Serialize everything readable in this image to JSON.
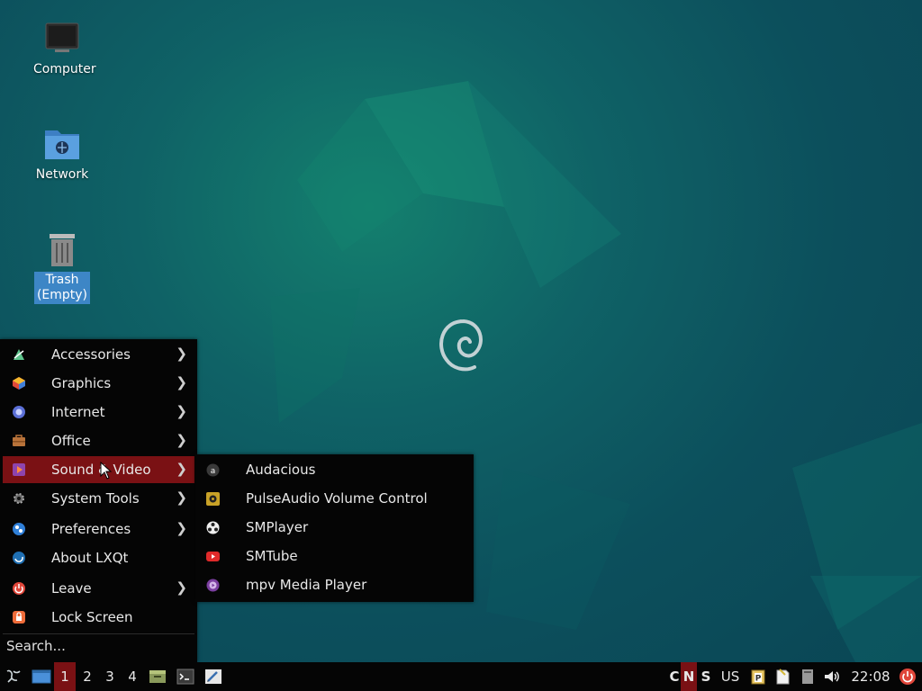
{
  "desktop": {
    "icons": [
      {
        "label": "Computer"
      },
      {
        "label": "Network"
      },
      {
        "label": "Trash\n(Empty)",
        "line1": "Trash",
        "line2": "(Empty)"
      }
    ]
  },
  "menu": {
    "items": [
      {
        "label": "Accessories",
        "icon": "accessories-icon",
        "submenu": true
      },
      {
        "label": "Graphics",
        "icon": "graphics-icon",
        "submenu": true
      },
      {
        "label": "Internet",
        "icon": "internet-icon",
        "submenu": true
      },
      {
        "label": "Office",
        "icon": "office-icon",
        "submenu": true
      },
      {
        "label": "Sound & Video",
        "icon": "sound-video-icon",
        "submenu": true,
        "active": true
      },
      {
        "label": "System Tools",
        "icon": "system-tools-icon",
        "submenu": true
      },
      {
        "label": "Preferences",
        "icon": "preferences-icon",
        "submenu": true
      },
      {
        "label": "About LXQt",
        "icon": "about-lxqt-icon",
        "submenu": false
      },
      {
        "label": "Leave",
        "icon": "leave-icon",
        "submenu": true
      },
      {
        "label": "Lock Screen",
        "icon": "lock-screen-icon",
        "submenu": false
      }
    ],
    "arrow": "❯",
    "search_placeholder": "Search..."
  },
  "submenu": {
    "items": [
      {
        "label": "Audacious",
        "icon": "audacious-icon"
      },
      {
        "label": "PulseAudio Volume Control",
        "icon": "pulseaudio-icon"
      },
      {
        "label": "SMPlayer",
        "icon": "smplayer-icon"
      },
      {
        "label": "SMTube",
        "icon": "smtube-icon"
      },
      {
        "label": "mpv Media Player",
        "icon": "mpv-icon"
      }
    ]
  },
  "taskbar": {
    "workspaces": [
      "1",
      "2",
      "3",
      "4"
    ],
    "active_workspace": "1",
    "keyboard_indicators": [
      "C",
      "N",
      "S"
    ],
    "active_indicator": "N",
    "layout": "US",
    "clock": "22:08"
  },
  "colors": {
    "accent": "#7a1114",
    "menu_bg": "#050505",
    "selection": "#3d86c6"
  }
}
